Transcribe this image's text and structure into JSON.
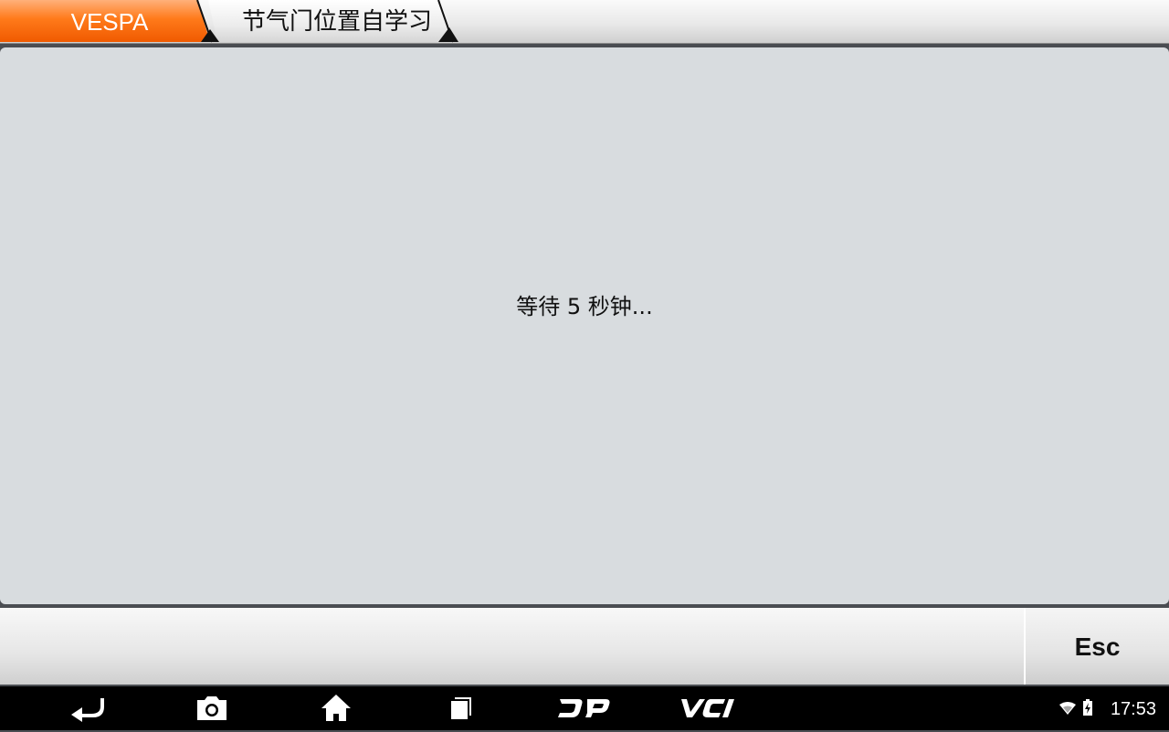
{
  "breadcrumb": {
    "items": [
      {
        "label": "VESPA",
        "active": true
      },
      {
        "label": "节气门位置自学习",
        "active": false
      }
    ]
  },
  "main": {
    "message": "等待 5 秒钟..."
  },
  "actions": {
    "esc_label": "Esc"
  },
  "navbar": {
    "buttons": [
      "back-icon",
      "camera-icon",
      "home-icon",
      "recent-apps-icon",
      "dp-icon",
      "vci-icon"
    ],
    "dp_label": "DP",
    "vci_label": "VCI"
  },
  "status": {
    "time": "17:53",
    "icons": [
      "wifi-icon",
      "battery-charging-icon"
    ]
  },
  "colors": {
    "accent": "#ff6a00",
    "panel": "#d8dcdf"
  }
}
